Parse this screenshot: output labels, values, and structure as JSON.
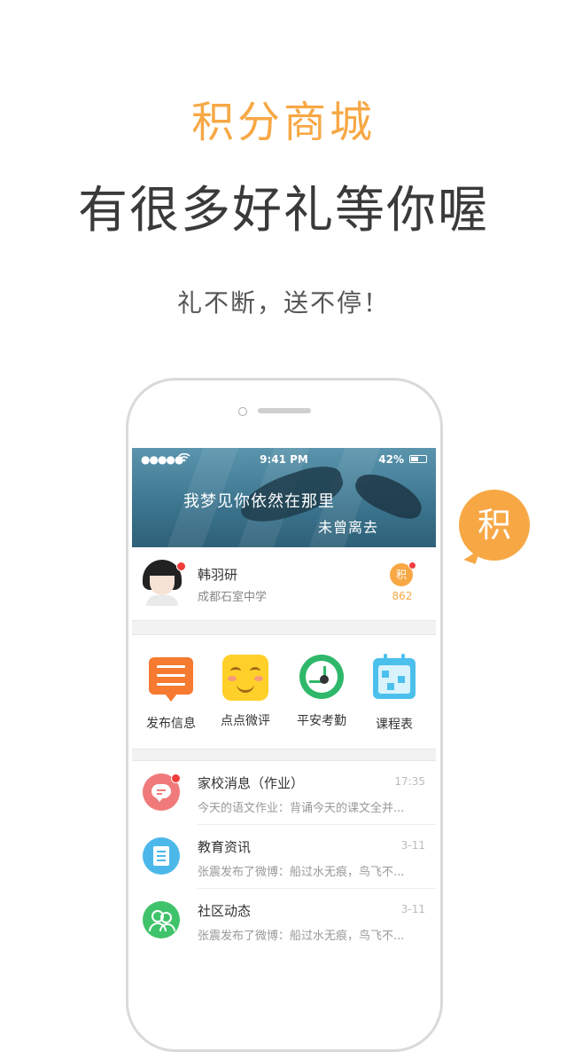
{
  "headline": "积分商城",
  "subheadline": "有很多好礼等你喔",
  "tagline": "礼不断，送不停！",
  "float_badge": "积",
  "colors": {
    "accent": "#f7a845",
    "title": "#3a3a3a"
  },
  "status_bar": {
    "signal": "●●●●●",
    "time": "9:41 PM",
    "battery": "42%"
  },
  "banner": {
    "line1": "我梦见你依然在那里",
    "line2": "未曾离去"
  },
  "profile": {
    "name": "韩羽研",
    "school": "成都石室中学",
    "points_label": "积",
    "points": "862"
  },
  "features": [
    {
      "label": "发布信息",
      "icon": "post-icon"
    },
    {
      "label": "点点微评",
      "icon": "smile-icon"
    },
    {
      "label": "平安考勤",
      "icon": "clock-icon"
    },
    {
      "label": "课程表",
      "icon": "calendar-icon"
    }
  ],
  "messages": [
    {
      "title": "家校消息（作业）",
      "time": "17:35",
      "preview": "今天的语文作业：背诵今天的课文全并...",
      "icon": "chat-icon",
      "color": "#f07a7a"
    },
    {
      "title": "教育资讯",
      "time": "3-11",
      "preview": "张震发布了微博：船过水无痕，鸟飞不...",
      "icon": "news-icon",
      "color": "#4cb8ea"
    },
    {
      "title": "社区动态",
      "time": "3-11",
      "preview": "张震发布了微博：船过水无痕，鸟飞不...",
      "icon": "people-icon",
      "color": "#3fc36a"
    }
  ]
}
